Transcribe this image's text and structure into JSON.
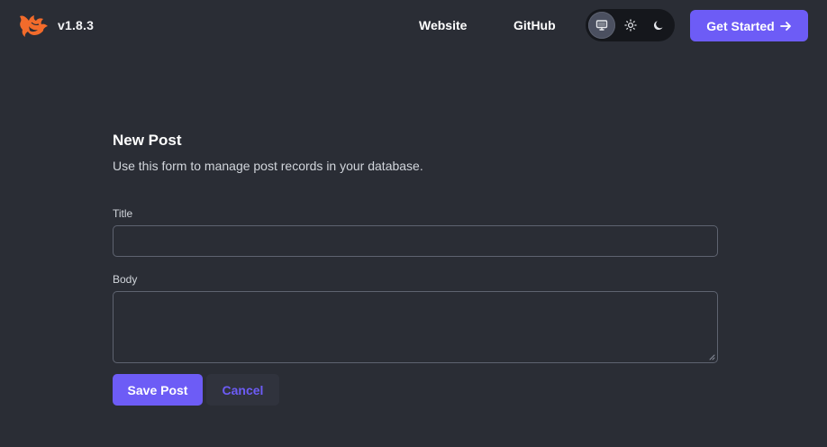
{
  "header": {
    "logo_icon": "phoenix-logo-icon",
    "version": "v1.8.3",
    "nav": {
      "website_label": "Website",
      "github_label": "GitHub"
    },
    "theme_toggle": {
      "options": [
        {
          "icon": "monitor-icon",
          "active": true
        },
        {
          "icon": "sun-icon",
          "active": false
        },
        {
          "icon": "moon-icon",
          "active": false
        }
      ]
    },
    "cta": {
      "label": "Get Started",
      "icon": "arrow-right-icon",
      "color": "#6d5cf6"
    }
  },
  "form": {
    "title": "New Post",
    "subtitle": "Use this form to manage post records in your database.",
    "fields": {
      "title_label": "Title",
      "title_value": "",
      "body_label": "Body",
      "body_value": ""
    },
    "actions": {
      "save_label": "Save Post",
      "cancel_label": "Cancel"
    }
  },
  "colors": {
    "background": "#2a2d35",
    "accent": "#6d5cf6",
    "logo": "#f26b2b"
  }
}
